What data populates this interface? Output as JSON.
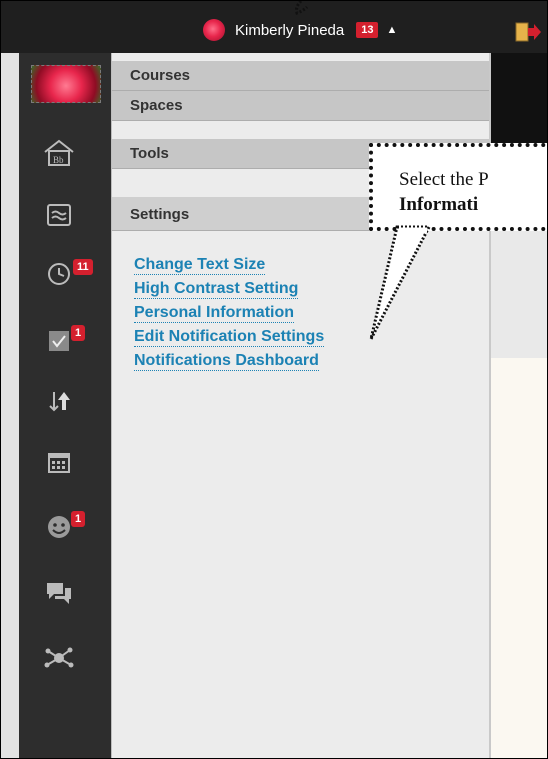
{
  "header": {
    "user_name": "Kimberly Pineda",
    "notification_count": "13",
    "caret_glyph": "▲"
  },
  "sidebar": {
    "icons": [
      {
        "name": "avatar-icon"
      },
      {
        "name": "home-bb-icon"
      },
      {
        "name": "activity-stream-icon"
      },
      {
        "name": "due-dates-icon",
        "badge": "11"
      },
      {
        "name": "grades-icon",
        "badge": "1"
      },
      {
        "name": "sort-icon"
      },
      {
        "name": "calendar-icon"
      },
      {
        "name": "people-icon",
        "badge": "1"
      },
      {
        "name": "messages-icon"
      },
      {
        "name": "network-icon"
      }
    ]
  },
  "menu": {
    "sections": [
      "Courses",
      "Spaces",
      "Tools",
      "Settings"
    ],
    "settings_links": [
      "Change Text Size",
      "High Contrast Setting",
      "Personal Information",
      "Edit Notification Settings",
      "Notifications Dashboard"
    ]
  },
  "callout": {
    "line1": "Select the ",
    "line1_cut": "P",
    "line2": "Informati"
  },
  "colors": {
    "topbar": "#1f1f1f",
    "sidebar": "#2d2d2d",
    "link": "#1c82b4",
    "badge": "#d4202e"
  }
}
